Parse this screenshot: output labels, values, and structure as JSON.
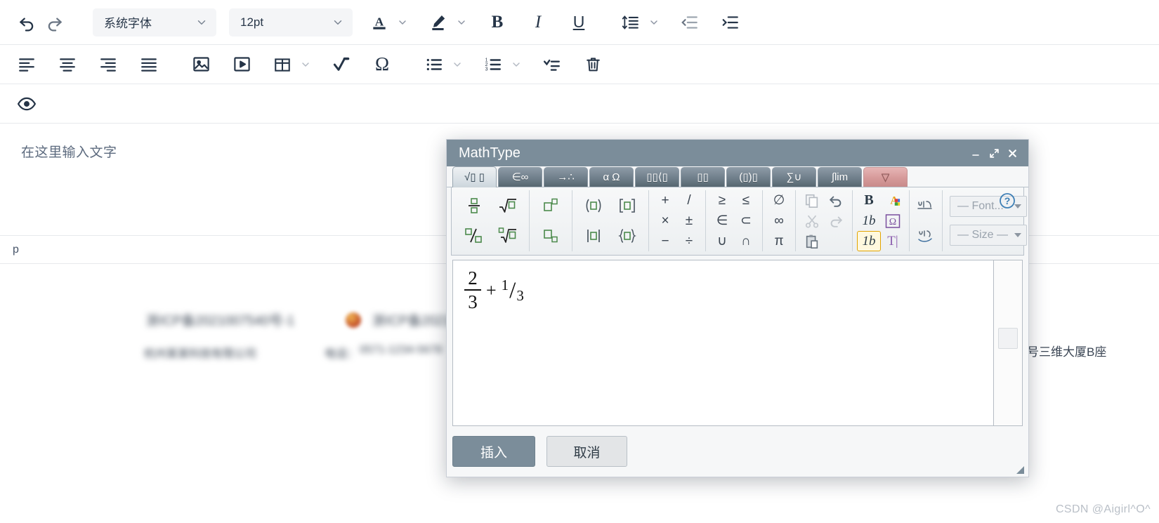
{
  "editor": {
    "toolbar_row1": {
      "undo": "undo-icon",
      "redo": "redo-icon",
      "font_family_value": "系统字体",
      "font_size_value": "12pt",
      "text_color": "text-color-icon",
      "highlight_color": "highlight-color-icon",
      "bold": "B",
      "italic": "I",
      "underline": "U",
      "line_height": "line-height-icon",
      "outdent": "outdent-icon",
      "indent": "indent-icon"
    },
    "toolbar_row2": {
      "align_left": "align-left-icon",
      "align_center": "align-center-icon",
      "align_right": "align-right-icon",
      "align_justify": "align-justify-icon",
      "image": "image-icon",
      "video": "video-icon",
      "table": "table-icon",
      "formula": "formula-icon",
      "special_char": "Ω",
      "bullet_list": "bullet-list-icon",
      "numbered_list": "numbered-list-icon",
      "todo_list": "todo-list-icon",
      "clear": "trash-icon"
    },
    "toolbar_row3": {
      "preview": "eye-icon"
    },
    "content_placeholder": "在这里输入文字",
    "status_path": "p",
    "background_text": {
      "line1": "浙ICP备2021007540号-1",
      "line2": "杭州某某科技有限公司",
      "line3_label": "电话：",
      "line3_value": "0571-1234-5678",
      "line4_right": "号三维大厦B座"
    },
    "watermark": "CSDN @Aigirl^O^"
  },
  "mathtype": {
    "title": "MathType",
    "window_buttons": {
      "minimize": "minimize-icon",
      "maximize": "maximize-icon",
      "close": "close-icon"
    },
    "help": "?",
    "tabs": [
      {
        "label": "√▯ ▯",
        "name": "tab-fractions-radicals",
        "active": true,
        "style": "normal"
      },
      {
        "label": "∈∞",
        "name": "tab-sets-operators",
        "active": false,
        "style": "normal"
      },
      {
        "label": "→∴",
        "name": "tab-arrows-logic",
        "active": false,
        "style": "normal"
      },
      {
        "label": "α Ω",
        "name": "tab-greek-letters",
        "active": false,
        "style": "normal"
      },
      {
        "label": "▯▯⟨▯",
        "name": "tab-matrices",
        "active": false,
        "style": "normal"
      },
      {
        "label": "▯▯",
        "name": "tab-scripts",
        "active": false,
        "style": "normal"
      },
      {
        "label": "(▯)▯",
        "name": "tab-accents",
        "active": false,
        "style": "normal"
      },
      {
        "label": "∑∪",
        "name": "tab-big-operators",
        "active": false,
        "style": "normal"
      },
      {
        "label": "∫lim",
        "name": "tab-integrals-limits",
        "active": false,
        "style": "normal"
      },
      {
        "label": "▽",
        "name": "tab-more",
        "active": false,
        "style": "red"
      }
    ],
    "palette": {
      "templates_group": {
        "row1": [
          "stacked-fraction",
          "square-root"
        ],
        "row2": [
          "slash-fraction",
          "nth-root"
        ]
      },
      "scripts_group": {
        "row1": [
          "superscript",
          "paren-template"
        ],
        "row2": [
          "subscript",
          "abs-value-template"
        ]
      },
      "brackets_group": {
        "row1": [
          "bracket-template"
        ],
        "row2": [
          "brace-template"
        ]
      },
      "operators_group": {
        "row1": [
          "+",
          "/"
        ],
        "row2": [
          "×",
          "±"
        ],
        "row3": [
          "−",
          "÷"
        ]
      },
      "relations_group": {
        "row1": [
          "≥",
          "≤"
        ],
        "row2": [
          "∈",
          "⊂"
        ],
        "row3": [
          "∪",
          "∩"
        ]
      },
      "symbols_group": {
        "row1": [
          "∅"
        ],
        "row2": [
          "∞"
        ],
        "row3": [
          "π"
        ]
      },
      "clipboard_group": {
        "row1": [
          "copy-icon",
          "undo-icon"
        ],
        "row2": [
          "cut-icon",
          "redo-icon"
        ],
        "row3": [
          "paste-icon"
        ]
      },
      "format_group": {
        "row1": [
          "bold-B",
          "color-A-icon"
        ],
        "row2": [
          "italic-1b",
          "omega-box-icon"
        ],
        "row3": [
          "style-1b-selected",
          "text-T-icon"
        ]
      },
      "rtl_group": {
        "row1": [
          "arabic-script-icon"
        ],
        "row2": [
          "arabic-script-icon-2"
        ]
      },
      "font_combo": "— Font...",
      "size_combo": "— Size —"
    },
    "formula": {
      "fraction1_numerator": "2",
      "fraction1_denominator": "3",
      "operator": "+",
      "fraction2_numerator": "1",
      "fraction2_slash": "/",
      "fraction2_denominator": "3",
      "plain_text": "2/3 + 1/3"
    },
    "insert_button": "插入",
    "cancel_button": "取消"
  },
  "colors": {
    "title_bar": "#7b8d9a",
    "dialog_bg": "#f6f7f8",
    "tab_red": "#d79b9b",
    "toolbar_icon": "#253447",
    "template_green": "#4c8a4c",
    "highlight_yellow": "#e2a400"
  }
}
